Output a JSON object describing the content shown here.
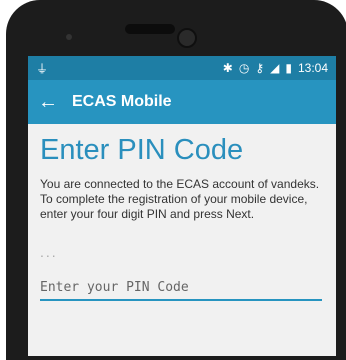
{
  "status_bar": {
    "time": "13:04",
    "icons": [
      "usb-icon",
      "bluetooth-icon",
      "alarm-icon",
      "key-icon",
      "signal-icon",
      "battery-icon"
    ]
  },
  "app_bar": {
    "title": "ECAS Mobile",
    "back_icon": "back-arrow-icon"
  },
  "main": {
    "heading": "Enter PIN Code",
    "description": "You are connected to the ECAS account of vandeks. To complete the registration of your mobile device, enter your four digit PIN and press Next.",
    "dots": "...",
    "pin_placeholder": "Enter your PIN Code"
  },
  "colors": {
    "status_bar": "#1e7ea5",
    "app_bar": "#2794c0",
    "heading": "#2a8fbd",
    "screen_background": "#f1f1f1"
  }
}
